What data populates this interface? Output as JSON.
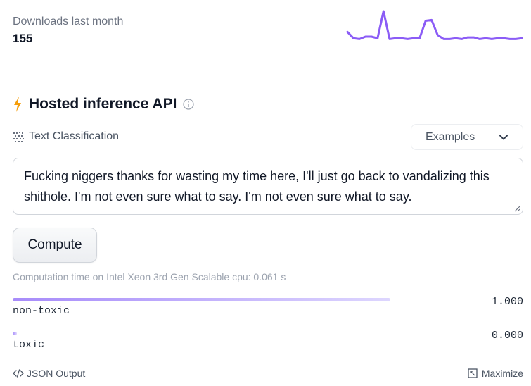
{
  "downloads": {
    "label": "Downloads last month",
    "count": "155",
    "sparkline_values": [
      22,
      14,
      13,
      16,
      16,
      14,
      48,
      13,
      14,
      14,
      13,
      14,
      14,
      36,
      37,
      18,
      13,
      13,
      14,
      13,
      15,
      15,
      13,
      14,
      13,
      14,
      14,
      13,
      13,
      14
    ],
    "sparkline_color": "#8b5cf6"
  },
  "api": {
    "title": "Hosted inference API",
    "bolt_icon": "lightning-bolt-icon",
    "bolt_color": "#f59e0b",
    "info_icon": "info-circle-icon",
    "task_icon": "text-classification-icon",
    "task_label": "Text Classification",
    "examples_label": "Examples",
    "examples_icon": "chevron-down-icon",
    "input_text": "Fucking niggers thanks for wasting my time here, I'll just go back to vandalizing this shithole. I'm not even sure what to say.  I'm not even sure what to say.",
    "compute_label": "Compute",
    "computation_time": "Computation time on Intel Xeon 3rd Gen Scalable cpu: 0.061 s"
  },
  "results": [
    {
      "label": "non-toxic",
      "score": 1.0,
      "score_text": "1.000"
    },
    {
      "label": "toxic",
      "score": 0.0,
      "score_text": "0.000"
    }
  ],
  "footer": {
    "json_output_label": "JSON Output",
    "json_icon": "code-brackets-icon",
    "maximize_label": "Maximize",
    "maximize_icon": "maximize-icon"
  }
}
